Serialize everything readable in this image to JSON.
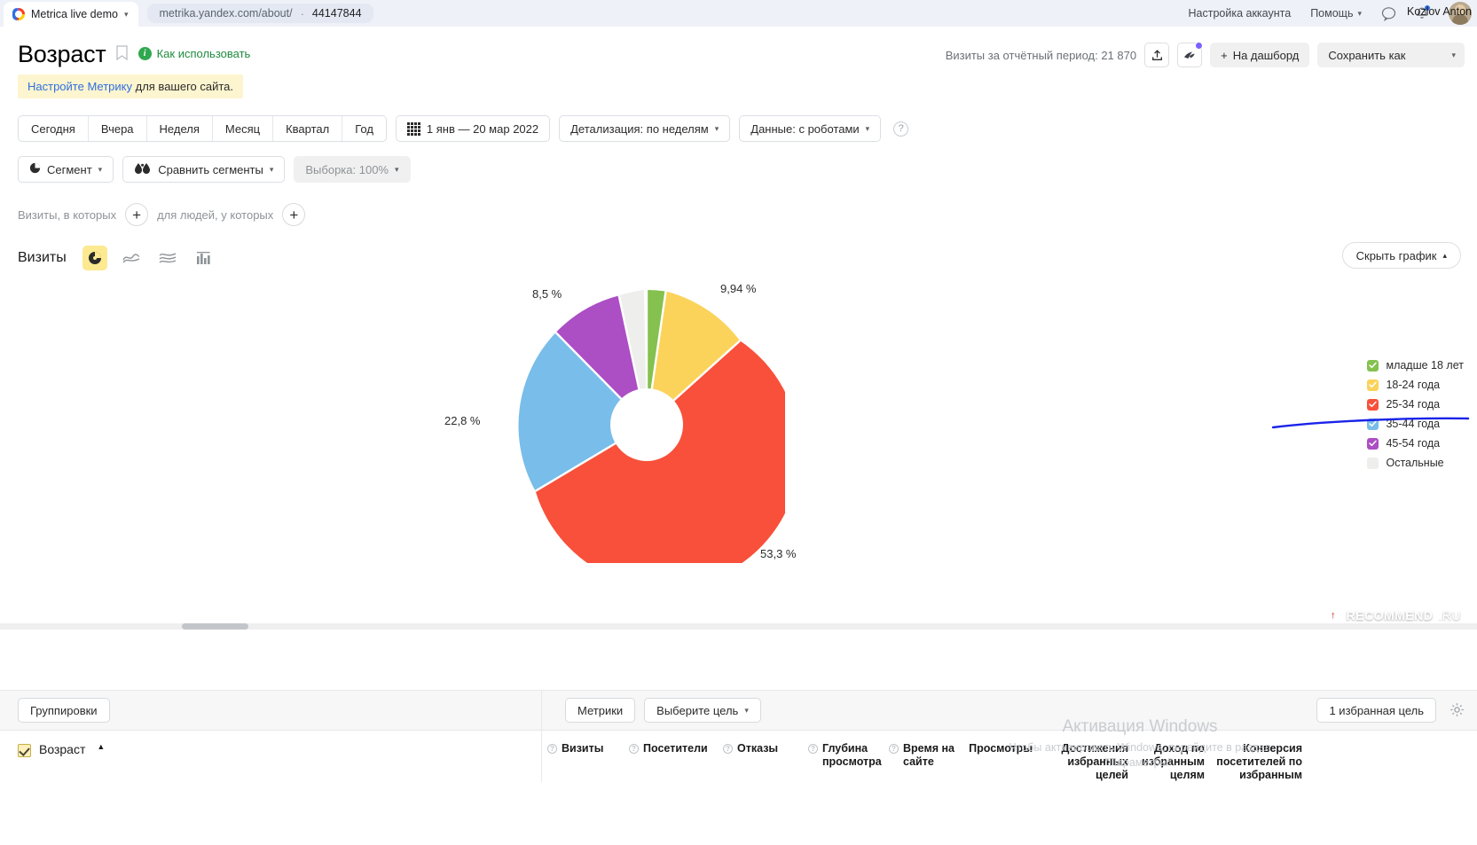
{
  "browser": {
    "tab_title": "Metrica live demo",
    "url": "metrika.yandex.com/about/",
    "counter_id": "44147844",
    "account_settings": "Настройка аккаунта",
    "help": "Помощь",
    "user_name": "Kozlov Anton"
  },
  "header": {
    "title": "Возраст",
    "how_to_use": "Как использовать",
    "tip_link": "Настройте Метрику",
    "tip_rest": " для вашего сайта.",
    "visits_summary": "Визиты за отчётный период: 21 870",
    "add_dashboard": "На дашборд",
    "save_as": "Сохранить как"
  },
  "filters": {
    "periods": [
      "Сегодня",
      "Вчера",
      "Неделя",
      "Месяц",
      "Квартал",
      "Год"
    ],
    "date_range": "1 янв — 20 мар 2022",
    "detail": "Детализация: по неделям",
    "data": "Данные: с роботами",
    "segment": "Сегмент",
    "compare_segments": "Сравнить сегменты",
    "sampling": "Выборка: 100%",
    "visits_where": "Визиты, в которых",
    "people_where": "для людей, у которых"
  },
  "chart_toolbar": {
    "metric_label": "Визиты",
    "hide_chart": "Скрыть график"
  },
  "chart_data": {
    "type": "pie",
    "title": "Возраст",
    "subtype": "donut",
    "categories": [
      "младше 18 лет",
      "18-24 года",
      "25-34 года",
      "35-44 года",
      "45-54 года",
      "Остальные"
    ],
    "values": [
      2.2,
      9.94,
      53.3,
      22.8,
      8.5,
      3.3
    ],
    "value_labels": [
      "",
      "9,94 %",
      "53,3 %",
      "22,8 %",
      "8,5 %",
      ""
    ],
    "colors": [
      "#84c14f",
      "#fbd35b",
      "#f8503a",
      "#79bdea",
      "#ac4ec4",
      "#eeeeec"
    ],
    "unit": "%",
    "legend_position": "right",
    "legend_entries": [
      {
        "label": "младше 18 лет",
        "color": "#84c14f",
        "checked": true
      },
      {
        "label": "18-24 года",
        "color": "#fbd35b",
        "checked": true
      },
      {
        "label": "25-34 года",
        "color": "#f8503a",
        "checked": true
      },
      {
        "label": "35-44 года",
        "color": "#79bdea",
        "checked": true
      },
      {
        "label": "45-54 года",
        "color": "#ac4ec4",
        "checked": true
      },
      {
        "label": "Остальные",
        "color": "#eeeeec",
        "checked": false
      }
    ]
  },
  "table": {
    "groupings_button": "Группировки",
    "metrics_button": "Метрики",
    "select_goal": "Выберите цель",
    "favorite_goal": "1 избранная цель",
    "dimension": "Возраст",
    "columns": [
      "Визиты",
      "Посетители",
      "Отказы",
      "Глубина просмотра",
      "Время на сайте",
      "Просмотры",
      "Достижения избранных целей",
      "Доход по избранным целям",
      "Конверсия посетителей по избранным"
    ]
  },
  "overlays": {
    "windows_activation_title": "Активация Windows",
    "windows_activation_text": "Чтобы активировать Windows, перейдите в раздел \"Параметры\".",
    "recommend_badge": "RECOMMEND",
    "recommend_tld": ".RU",
    "recommend_mark": "↑"
  },
  "colors": {
    "accent": "#fde98f",
    "link": "#2f6fe0",
    "green": "#1f8b3e",
    "scribble": "#1a24e8"
  }
}
